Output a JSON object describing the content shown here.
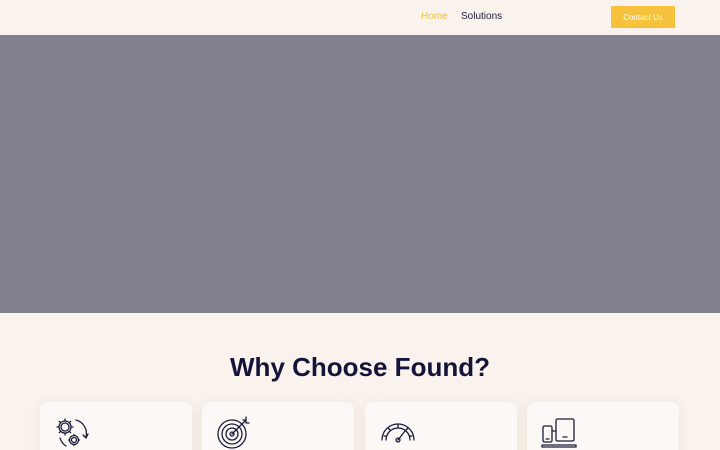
{
  "nav": {
    "home_label": "Home",
    "solutions_label": "Solutions",
    "contact_label": "Contact Us"
  },
  "section": {
    "title": "Why Choose Found?"
  },
  "cards": [
    {
      "icon": "gears-cycle-icon"
    },
    {
      "icon": "target-icon"
    },
    {
      "icon": "speedometer-icon"
    },
    {
      "icon": "devices-icon"
    }
  ],
  "colors": {
    "background": "#faf2ec",
    "accent": "#f7c23b",
    "nav_text": "#1d1b3c",
    "title": "#14133a",
    "hero_placeholder": "#82808d",
    "icon_stroke": "#1d1b3c"
  }
}
